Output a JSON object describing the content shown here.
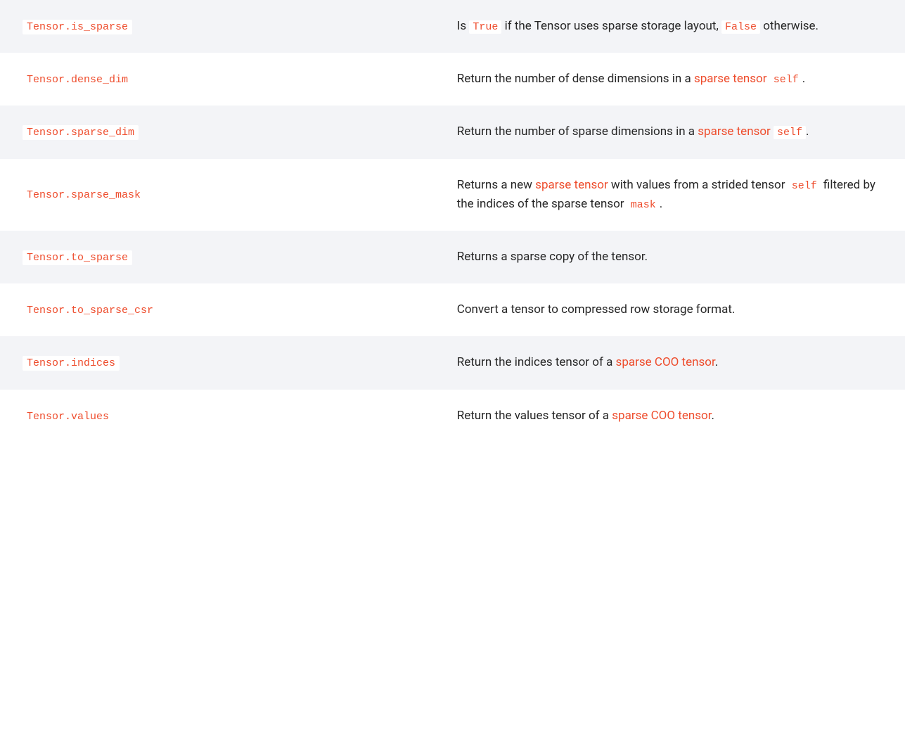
{
  "rows": [
    {
      "name": "Tensor.is_sparse",
      "desc": [
        {
          "t": "text",
          "v": "Is "
        },
        {
          "t": "code",
          "v": "True"
        },
        {
          "t": "text",
          "v": " if the Tensor uses sparse storage layout, "
        },
        {
          "t": "code",
          "v": "False"
        },
        {
          "t": "text",
          "v": " otherwise."
        }
      ]
    },
    {
      "name": "Tensor.dense_dim",
      "desc": [
        {
          "t": "text",
          "v": "Return the number of dense dimensions in a "
        },
        {
          "t": "link",
          "v": "sparse tensor"
        },
        {
          "t": "text",
          "v": " "
        },
        {
          "t": "code",
          "v": "self"
        },
        {
          "t": "text",
          "v": "."
        }
      ]
    },
    {
      "name": "Tensor.sparse_dim",
      "desc": [
        {
          "t": "text",
          "v": "Return the number of sparse dimensions in a "
        },
        {
          "t": "link",
          "v": "sparse tensor"
        },
        {
          "t": "text",
          "v": " "
        },
        {
          "t": "code",
          "v": "self"
        },
        {
          "t": "text",
          "v": "."
        }
      ]
    },
    {
      "name": "Tensor.sparse_mask",
      "desc": [
        {
          "t": "text",
          "v": "Returns a new "
        },
        {
          "t": "link",
          "v": "sparse tensor"
        },
        {
          "t": "text",
          "v": " with values from a strided tensor "
        },
        {
          "t": "code",
          "v": "self"
        },
        {
          "t": "text",
          "v": " filtered by the indices of the sparse tensor "
        },
        {
          "t": "code",
          "v": "mask"
        },
        {
          "t": "text",
          "v": "."
        }
      ]
    },
    {
      "name": "Tensor.to_sparse",
      "desc": [
        {
          "t": "text",
          "v": "Returns a sparse copy of the tensor."
        }
      ]
    },
    {
      "name": "Tensor.to_sparse_csr",
      "desc": [
        {
          "t": "text",
          "v": "Convert a tensor to compressed row storage format."
        }
      ]
    },
    {
      "name": "Tensor.indices",
      "desc": [
        {
          "t": "text",
          "v": "Return the indices tensor of a "
        },
        {
          "t": "link",
          "v": "sparse COO tensor"
        },
        {
          "t": "text",
          "v": "."
        }
      ]
    },
    {
      "name": "Tensor.values",
      "desc": [
        {
          "t": "text",
          "v": "Return the values tensor of a "
        },
        {
          "t": "link",
          "v": "sparse COO tensor"
        },
        {
          "t": "text",
          "v": "."
        }
      ]
    }
  ]
}
